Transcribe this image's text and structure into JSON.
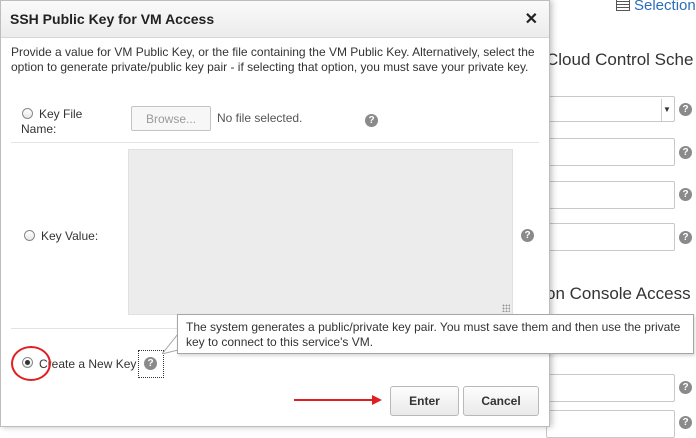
{
  "background": {
    "selection_label": "Selection",
    "heading_scheme": "Cloud Control Sche",
    "heading_console": "on Console Access",
    "help_icon_label": "?"
  },
  "dialog": {
    "title": "SSH Public Key for VM Access",
    "close_label": "✕",
    "description": "Provide a value for VM Public Key, or the file containing the VM Public Key. Alternatively, select the option to generate private/public key pair - if selecting that option, you must save your private key.",
    "options": {
      "key_file": {
        "label_line1": "Key File",
        "label_line2": "Name:",
        "browse_label": "Browse...",
        "file_status": "No file selected.",
        "selected": false
      },
      "key_value": {
        "label": "Key Value:",
        "value": "",
        "selected": false
      },
      "new_key": {
        "label": "Create a New Key",
        "selected": true
      }
    },
    "help_icon_label": "?",
    "tooltip_text": "The system generates a public/private key pair. You must save them and then use the private key to connect to this service's VM.",
    "buttons": {
      "enter": "Enter",
      "cancel": "Cancel"
    }
  },
  "colors": {
    "annotation": "#e02020",
    "link": "#2a6ebb"
  }
}
